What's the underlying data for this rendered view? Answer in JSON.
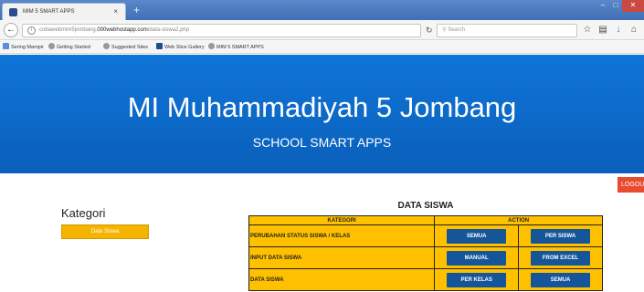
{
  "browser": {
    "tab_title": "MIM 5 SMART APPS",
    "tab_close": "×",
    "new_tab": "+",
    "url_prefix": "cobawebmim5jombang.",
    "url_domain": "000webhostapp.com",
    "url_path": "/data-siswa2.php",
    "search_placeholder": "Search",
    "bookmarks": [
      "Sering Mampir",
      "Getting Started",
      "Suggested Sites",
      "Web Slice Gallery",
      "MIM 5 SMART APPS"
    ]
  },
  "banner": {
    "title": "MI Muhammadiyah 5 Jombang",
    "subtitle": "SCHOOL SMART APPS"
  },
  "logout_label": "LOGOUT",
  "sidebar": {
    "title": "Kategori",
    "button_label": "Data Siswa"
  },
  "main": {
    "title": "DATA SISWA",
    "columns": [
      "KATEGORI",
      "ACTION"
    ],
    "rows": [
      {
        "label": "PERUBAHAN STATUS SISWA / KELAS",
        "actions": [
          "SEMUA",
          "PER SISWA"
        ]
      },
      {
        "label": "INPUT DATA SISWA",
        "actions": [
          "MANUAL",
          "FROM EXCEL"
        ]
      },
      {
        "label": "DATA SISWA",
        "actions": [
          "PER KELAS",
          "SEMUA"
        ]
      }
    ]
  },
  "colors": {
    "banner": "#0a6ad0",
    "table_bg": "#ffc000",
    "action_button": "#15569b",
    "logout": "#e84b2f"
  }
}
